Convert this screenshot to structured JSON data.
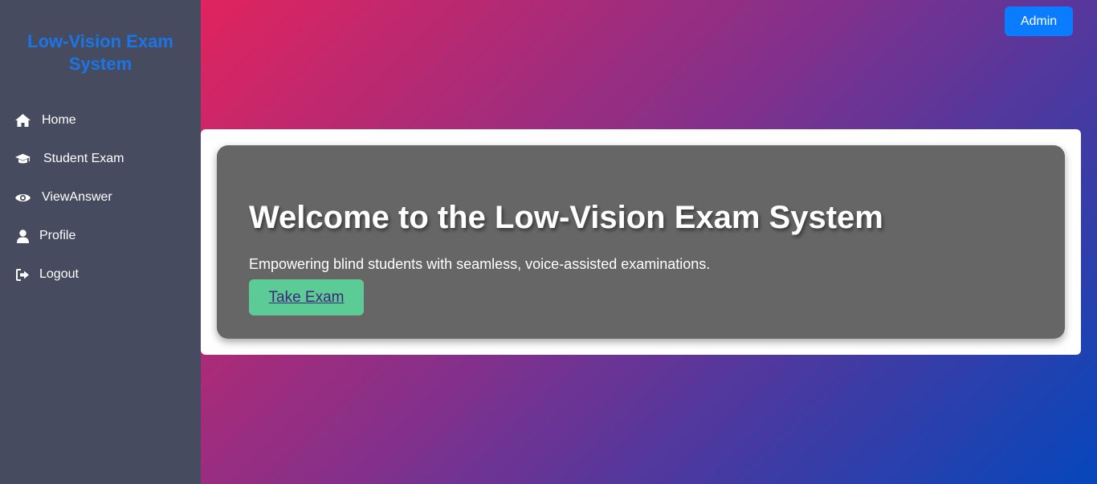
{
  "sidebar": {
    "brand": "Low-Vision Exam System",
    "items": [
      {
        "label": "Home",
        "icon": "home-icon"
      },
      {
        "label": "Student Exam",
        "icon": "graduation-cap-icon"
      },
      {
        "label": "ViewAnswer",
        "icon": "eye-icon"
      },
      {
        "label": "Profile",
        "icon": "user-icon"
      },
      {
        "label": "Logout",
        "icon": "sign-out-icon"
      }
    ]
  },
  "header": {
    "admin_label": "Admin"
  },
  "hero": {
    "title": "Welcome to the Low-Vision Exam System",
    "subtitle": "Empowering blind students with seamless, voice-assisted examinations.",
    "cta_label": "Take Exam"
  },
  "colors": {
    "sidebar_bg": "#474b5f",
    "brand": "#1a75e8",
    "admin_button": "#0a7cff",
    "hero_bg": "#666666",
    "cta_bg": "#5ccb95",
    "gradient_start": "#e0245e",
    "gradient_end": "#0547bb"
  }
}
